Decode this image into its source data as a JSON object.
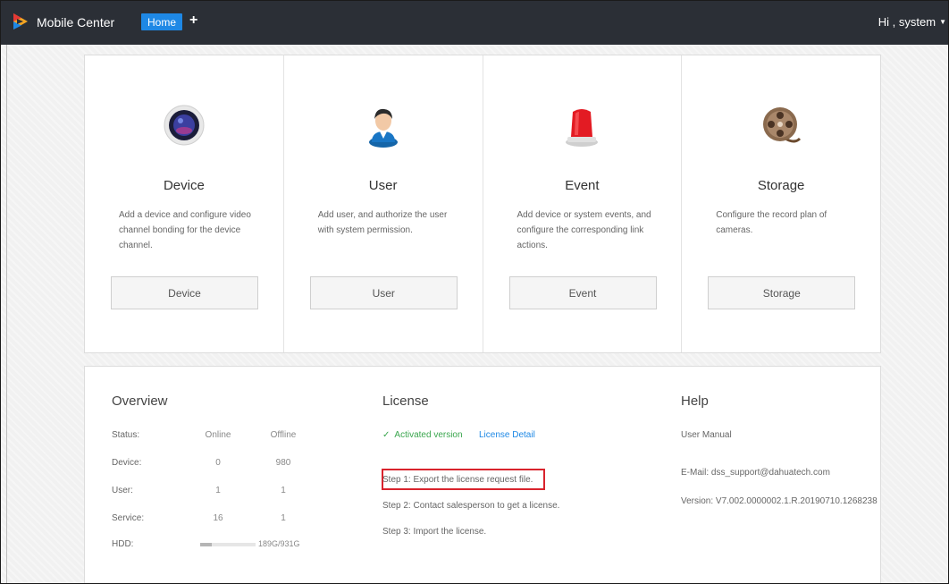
{
  "app": {
    "title": "Mobile Center",
    "user_greeting": "Hi , system"
  },
  "tabs": [
    {
      "label": "Home"
    },
    {
      "label": "+"
    }
  ],
  "icons": {
    "logo": "dahua-logo-icon",
    "device": "camera-lens-icon",
    "user": "user-avatar-icon",
    "event": "alarm-siren-icon",
    "storage": "film-reel-icon",
    "caret": "chevron-down-icon",
    "check": "check-icon"
  },
  "colors": {
    "topbar": "#2b2f36",
    "accent": "#1e88e5",
    "success": "#3aa64e",
    "highlight": "#d9232d"
  },
  "cards": [
    {
      "title": "Device",
      "desc": "Add a device and configure video channel bonding for the device channel.",
      "button": "Device"
    },
    {
      "title": "User",
      "desc": "Add user, and authorize the user with system permission.",
      "button": "User"
    },
    {
      "title": "Event",
      "desc": "Add device or system events, and configure the corresponding link actions.",
      "button": "Event"
    },
    {
      "title": "Storage",
      "desc": "Configure the record plan of cameras.",
      "button": "Storage"
    }
  ],
  "overview": {
    "title": "Overview",
    "rows": [
      {
        "label": "Status:",
        "online": "Online",
        "offline": "Offline"
      },
      {
        "label": "Device:",
        "online": "0",
        "offline": "980"
      },
      {
        "label": "User:",
        "online": "1",
        "offline": "1"
      },
      {
        "label": "Service:",
        "online": "16",
        "offline": "1"
      }
    ],
    "hdd": {
      "label": "HDD:",
      "text": "189G/931G",
      "used_fraction": 0.203
    }
  },
  "license": {
    "title": "License",
    "status": "Activated version",
    "detail_link": "License Detail",
    "steps": [
      "Step 1:  Export the license request file.",
      "Step 2:  Contact salesperson to get a license.",
      "Step 3:  Import the license."
    ]
  },
  "help": {
    "title": "Help",
    "manual": "User Manual",
    "email": "E-Mail:  dss_support@dahuatech.com",
    "version": "Version:  V7.002.0000002.1.R.20190710.1268238"
  }
}
